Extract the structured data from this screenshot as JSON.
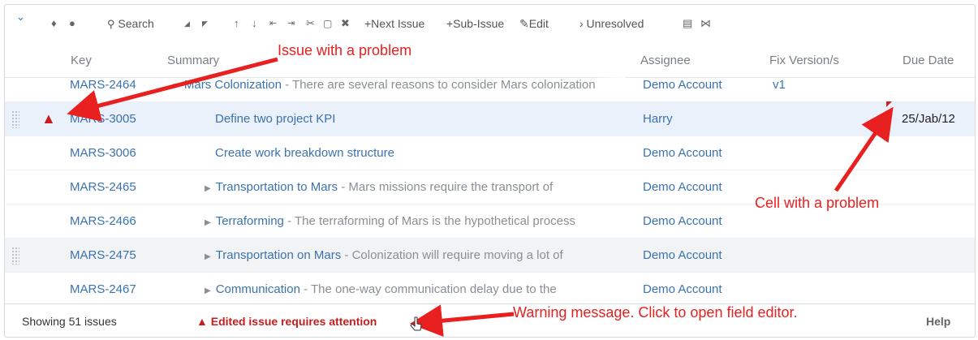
{
  "toolbar": {
    "collapse_icon": "chevron-down",
    "pin_glyph": "📌",
    "clock_glyph": "◷",
    "search_label": "Search",
    "move_up_left": "◢",
    "move_down_right": "◤",
    "up": "↑",
    "down": "↓",
    "outdent": "⇤",
    "indent": "⇥",
    "cut": "✂",
    "paste": "📋",
    "delete": "✖",
    "next_issue": "+Next Issue",
    "sub_issue": "+Sub-Issue",
    "edit": "Edit",
    "unresolved": "› Unresolved",
    "print": "🖶",
    "excel": "X"
  },
  "columns": {
    "key": "Key",
    "summary": "Summary",
    "assignee": "Assignee",
    "fix_version": "Fix Version/s",
    "due_date": "Due Date"
  },
  "rows": [
    {
      "key": "MARS-2464",
      "title": "Mars Colonization",
      "sep": " - ",
      "desc": "There are several reasons to consider Mars colonization",
      "assignee": "Demo Account",
      "fix": "v1",
      "due": "",
      "level": 0,
      "expanded": true
    },
    {
      "key": "MARS-3005",
      "title": "Define two project KPI",
      "sep": "",
      "desc": "",
      "assignee": "Harry",
      "fix": "",
      "due": "25/Jab/12",
      "level": 1,
      "problem": true
    },
    {
      "key": "MARS-3006",
      "title": "Create work breakdown structure",
      "sep": "",
      "desc": "",
      "assignee": "Demo Account",
      "fix": "",
      "due": "",
      "level": 1
    },
    {
      "key": "MARS-2465",
      "title": "Transportation to Mars",
      "sep": " - ",
      "desc": "Mars missions require the transport of",
      "assignee": "Demo Account",
      "fix": "",
      "due": "",
      "level": 0
    },
    {
      "key": "MARS-2466",
      "title": "Terraforming",
      "sep": " - ",
      "desc": "The terraforming of Mars is the hypothetical process",
      "assignee": "Demo Account",
      "fix": "",
      "due": "",
      "level": 0
    },
    {
      "key": "MARS-2475",
      "title": "Transportation on Mars",
      "sep": " - ",
      "desc": "Colonization will require moving a lot of",
      "assignee": "Demo Account",
      "fix": "",
      "due": "",
      "level": 0
    },
    {
      "key": "MARS-2467",
      "title": "Communication",
      "sep": " - ",
      "desc": "The one-way communication delay due to the",
      "assignee": "Demo Account",
      "fix": "",
      "due": "",
      "level": 0
    }
  ],
  "footer": {
    "count": "Showing 51 issues",
    "warning": "Edited issue requires attention",
    "help": "Help"
  },
  "annotations": {
    "issue_problem": "Issue with a problem",
    "cell_problem": "Cell with a problem",
    "warning_msg": "Warning message. Click to open field editor."
  },
  "colors": {
    "link": "#3b73af",
    "warning": "#c81d1d",
    "annotation": "#e8201f",
    "selected_row": "#eaf1fb"
  }
}
